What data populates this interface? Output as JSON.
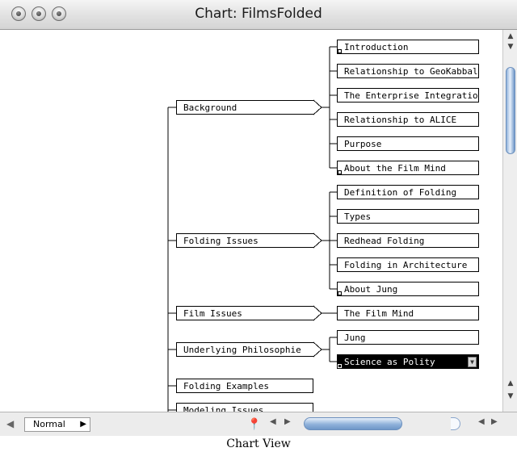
{
  "window": {
    "title": "Chart: FilmsFolded"
  },
  "chart": {
    "groups": [
      {
        "label": "Background",
        "has_children": true,
        "children": [
          {
            "label": "Introduction",
            "mark": true
          },
          {
            "label": "Relationship to GeoKabbal",
            "mark": false
          },
          {
            "label": "The Enterprise Integratio",
            "mark": false
          },
          {
            "label": "Relationship to ALICE",
            "mark": false
          },
          {
            "label": "Purpose",
            "mark": false
          },
          {
            "label": "About the Film Mind",
            "mark": true
          }
        ]
      },
      {
        "label": "Folding Issues",
        "has_children": true,
        "children": [
          {
            "label": "Definition of Folding",
            "mark": false
          },
          {
            "label": "Types",
            "mark": false
          },
          {
            "label": "Redhead Folding",
            "mark": false
          },
          {
            "label": "Folding in Architecture",
            "mark": false
          },
          {
            "label": "About Jung",
            "mark": true
          }
        ]
      },
      {
        "label": "Film Issues",
        "has_children": true,
        "children": [
          {
            "label": "The Film Mind",
            "mark": false
          }
        ]
      },
      {
        "label": "Underlying Philosophie",
        "has_children": true,
        "children": [
          {
            "label": "Jung",
            "mark": false
          },
          {
            "label": "Science as Polity",
            "mark": true,
            "selected": true
          }
        ]
      },
      {
        "label": "Folding Examples",
        "has_children": false,
        "children": []
      },
      {
        "label": "Modeling Issues",
        "has_children": false,
        "children": []
      }
    ]
  },
  "bottom": {
    "zoom_value": "Normal"
  },
  "caption": "Chart View"
}
